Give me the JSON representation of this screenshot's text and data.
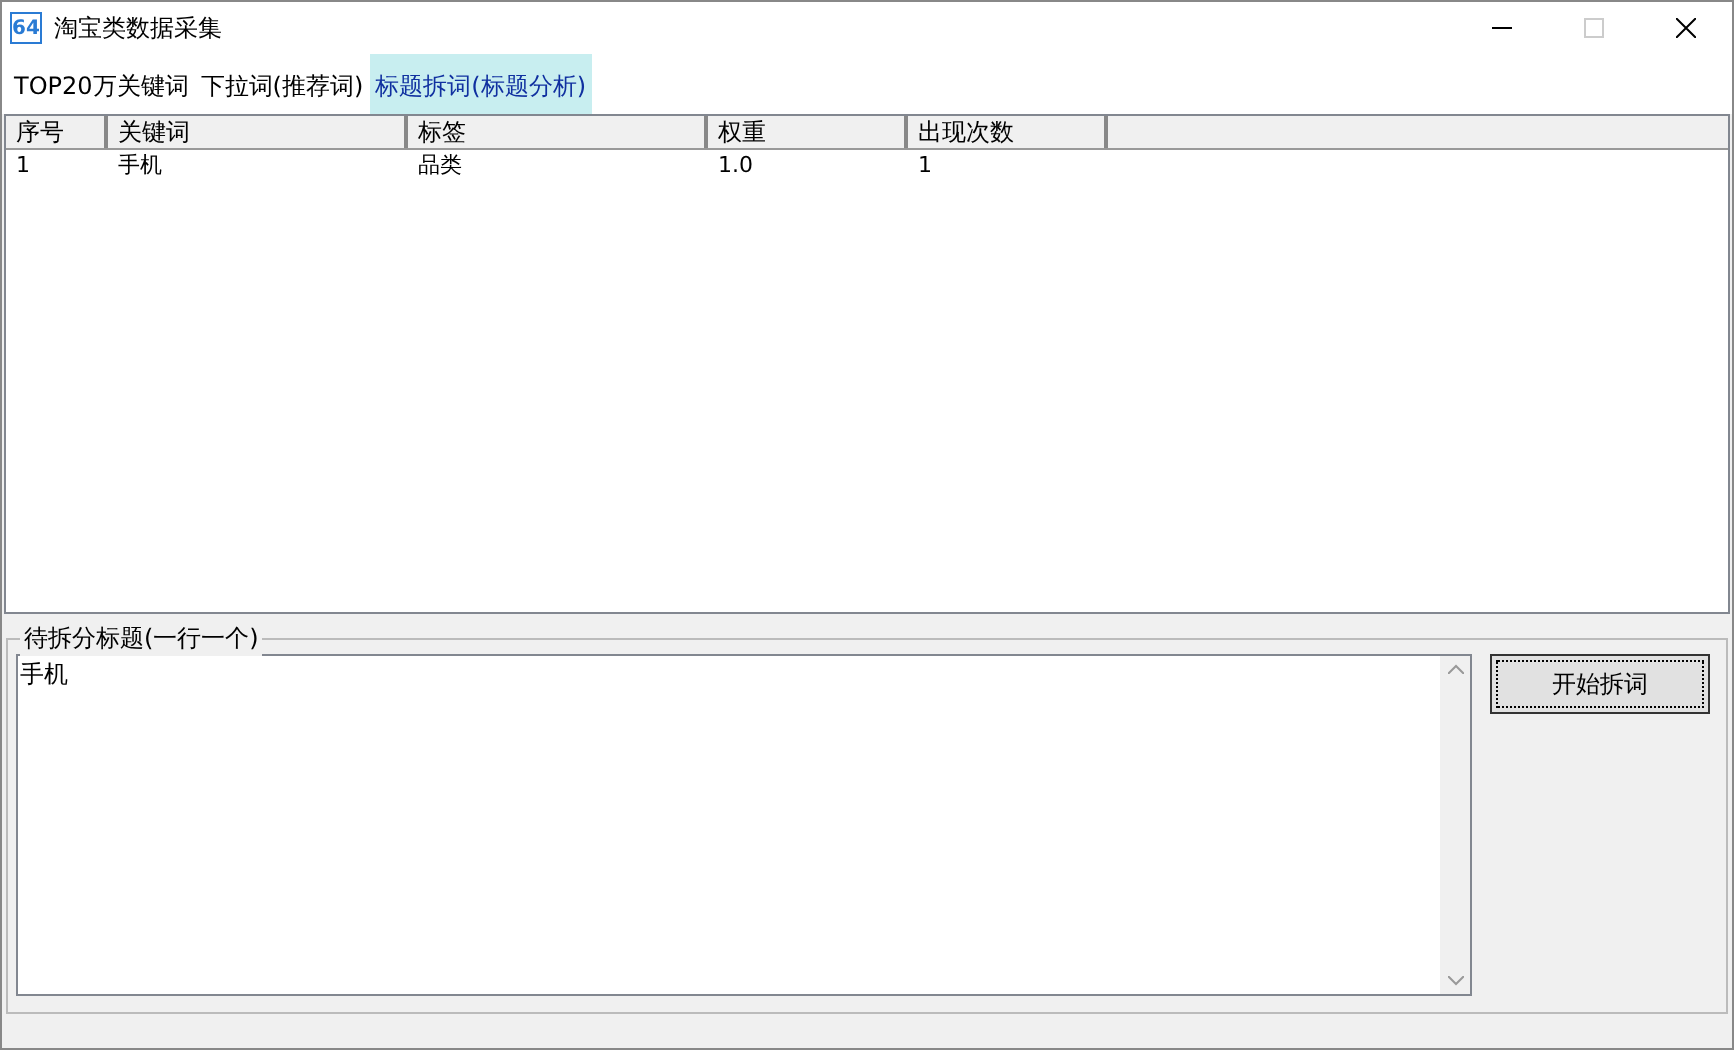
{
  "window": {
    "icon_label": "64",
    "title": "淘宝类数据采集",
    "maximize_disabled": true
  },
  "tabs": [
    {
      "label": "TOP20万关键词",
      "selected": false
    },
    {
      "label": "下拉词(推荐词)",
      "selected": false
    },
    {
      "label": "标题拆词(标题分析)",
      "selected": true
    }
  ],
  "table": {
    "columns": [
      "序号",
      "关键词",
      "标签",
      "权重",
      "出现次数"
    ],
    "rows": [
      [
        "1",
        "手机",
        "品类",
        "1.0",
        "1"
      ]
    ]
  },
  "split_group": {
    "label": "待拆分标题(一行一个)",
    "input": "手机",
    "button": "开始拆词"
  }
}
